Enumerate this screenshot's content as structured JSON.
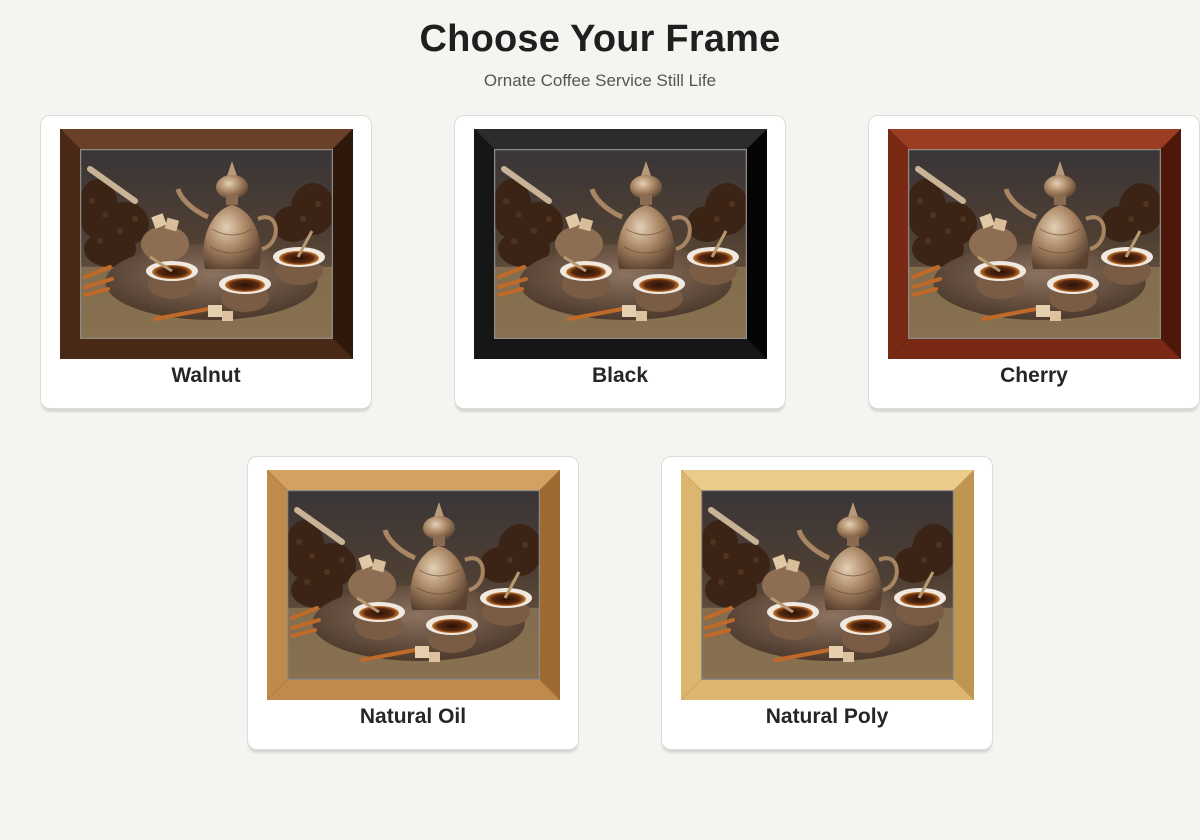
{
  "header": {
    "title": "Choose Your Frame",
    "subtitle": "Ornate Coffee Service Still Life"
  },
  "artwork": {
    "icon": "coffee-still-life-image"
  },
  "frames": [
    {
      "label": "Walnut",
      "color": "#4a2a17",
      "light": "#6a4128",
      "dark": "#2e180b"
    },
    {
      "label": "Black",
      "color": "#161616",
      "light": "#2c2c2c",
      "dark": "#050505"
    },
    {
      "label": "Cherry",
      "color": "#7a2a14",
      "light": "#9a3d22",
      "dark": "#4e170a"
    },
    {
      "label": "Natural Oil",
      "color": "#c08a4c",
      "light": "#d3a263",
      "dark": "#9d6a32"
    },
    {
      "label": "Natural Poly",
      "color": "#dcb66e",
      "light": "#ebcb89",
      "dark": "#bf9650"
    }
  ]
}
